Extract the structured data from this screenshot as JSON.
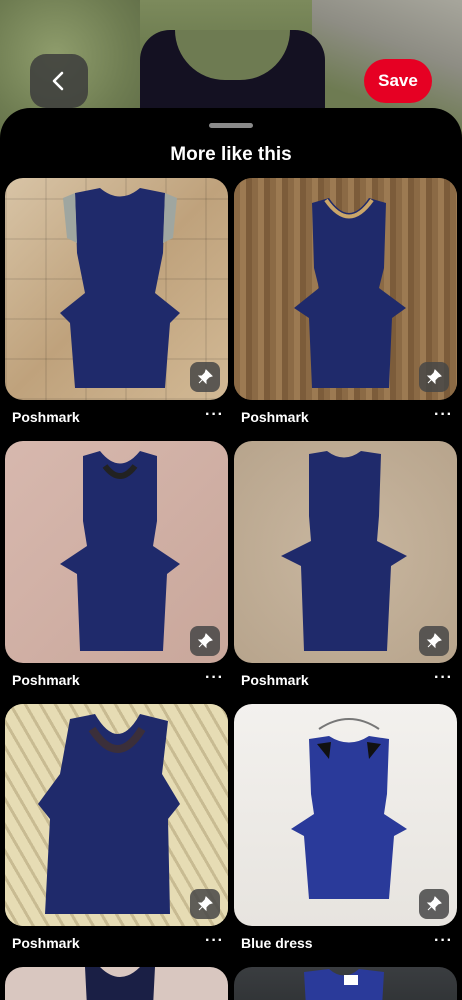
{
  "header": {
    "save_label": "Save",
    "back_icon": "chevron-left-icon"
  },
  "sheet": {
    "title": "More like this"
  },
  "colors": {
    "brand": "#e60023",
    "background": "#000000",
    "dress": "#1f2a6b"
  },
  "pins": [
    {
      "label": "Poshmark",
      "more": "···",
      "icon": "pin-icon"
    },
    {
      "label": "Poshmark",
      "more": "···",
      "icon": "pin-icon"
    },
    {
      "label": "Poshmark",
      "more": "···",
      "icon": "pin-icon"
    },
    {
      "label": "Poshmark",
      "more": "···",
      "icon": "pin-icon"
    },
    {
      "label": "Poshmark",
      "more": "···",
      "icon": "pin-icon"
    },
    {
      "label": "Blue dress",
      "more": "···",
      "icon": "pin-icon"
    }
  ]
}
